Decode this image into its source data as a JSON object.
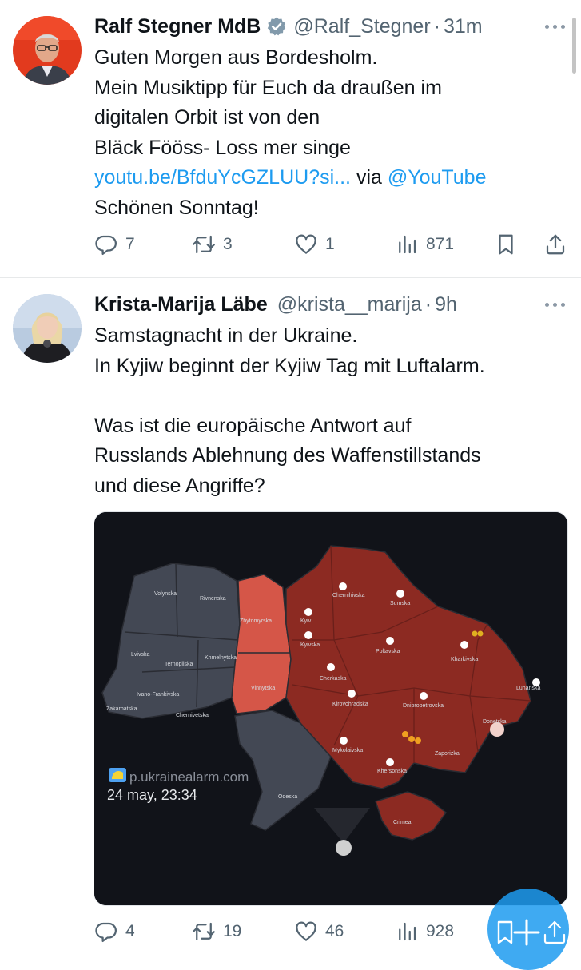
{
  "tweets": [
    {
      "author": "Ralf Stegner MdB",
      "handle": "@Ralf_Stegner",
      "separator": "·",
      "time": "31m",
      "verified": true,
      "text_lines": [
        "Guten Morgen aus Bordesholm.",
        "Mein Musiktipp für Euch da draußen im",
        "digitalen Orbit ist von den",
        "Bläck Fööss- Loss mer singe"
      ],
      "link_text": "youtu.be/BfduYcGZLUU?si...",
      "via_text": "via",
      "mention": "@YouTube",
      "last_line": "Schönen Sonntag!",
      "replies": "7",
      "reposts": "3",
      "likes": "1",
      "views": "871"
    },
    {
      "author": "Krista-Marija Läbe",
      "handle": "@krista__marija",
      "separator": "·",
      "time": "9h",
      "verified": false,
      "text_lines": [
        "Samstagnacht in der Ukraine.",
        "In Kyjiw beginnt der Kyjiw Tag mit Luftalarm.",
        "",
        "Was ist die europäische Antwort auf",
        "Russlands Ablehnung des Waffenstillstands",
        "und diese Angriffe?"
      ],
      "replies": "4",
      "reposts": "19",
      "likes": "46",
      "views": "928",
      "image": {
        "watermark": "p.ukrainealarm.com",
        "timestamp": "24 may, 23:34",
        "colors": {
          "background": "#111319",
          "calm": "#434854",
          "alert": "#8c2a22",
          "partial": "#d55648",
          "border": "#2a2c33"
        },
        "regions": {
          "volynska": "Volynska",
          "rivnenska": "Rivnenska",
          "lvivska": "Lvivska",
          "ternopilska": "Ternopilska",
          "khmelnytska": "Khmelnytska",
          "ivano_frankivska": "Ivano-Frankivska",
          "zakarpatska": "Zakarpatska",
          "chernivetska": "Chernivetska",
          "zhytomyrska": "Zhytomyrska",
          "vinnytska": "Vinnytska",
          "kyiv": "Kyiv",
          "kyivska": "Kyivska",
          "chernihivska": "Chernihivska",
          "sumska": "Sumska",
          "poltavska": "Poltavska",
          "kharkivska": "Kharkivska",
          "cherkaska": "Cherkaska",
          "kirovohradska": "Kirovohradska",
          "dnipropetrovska": "Dnipropetrovska",
          "luhanska": "Luhanska",
          "donetska": "Donetska",
          "zaporizka": "Zaporizka",
          "mykolaivska": "Mykolaivska",
          "khersonska": "Khersonska",
          "odeska": "Odeska",
          "crimea": "Crimea"
        }
      }
    }
  ]
}
